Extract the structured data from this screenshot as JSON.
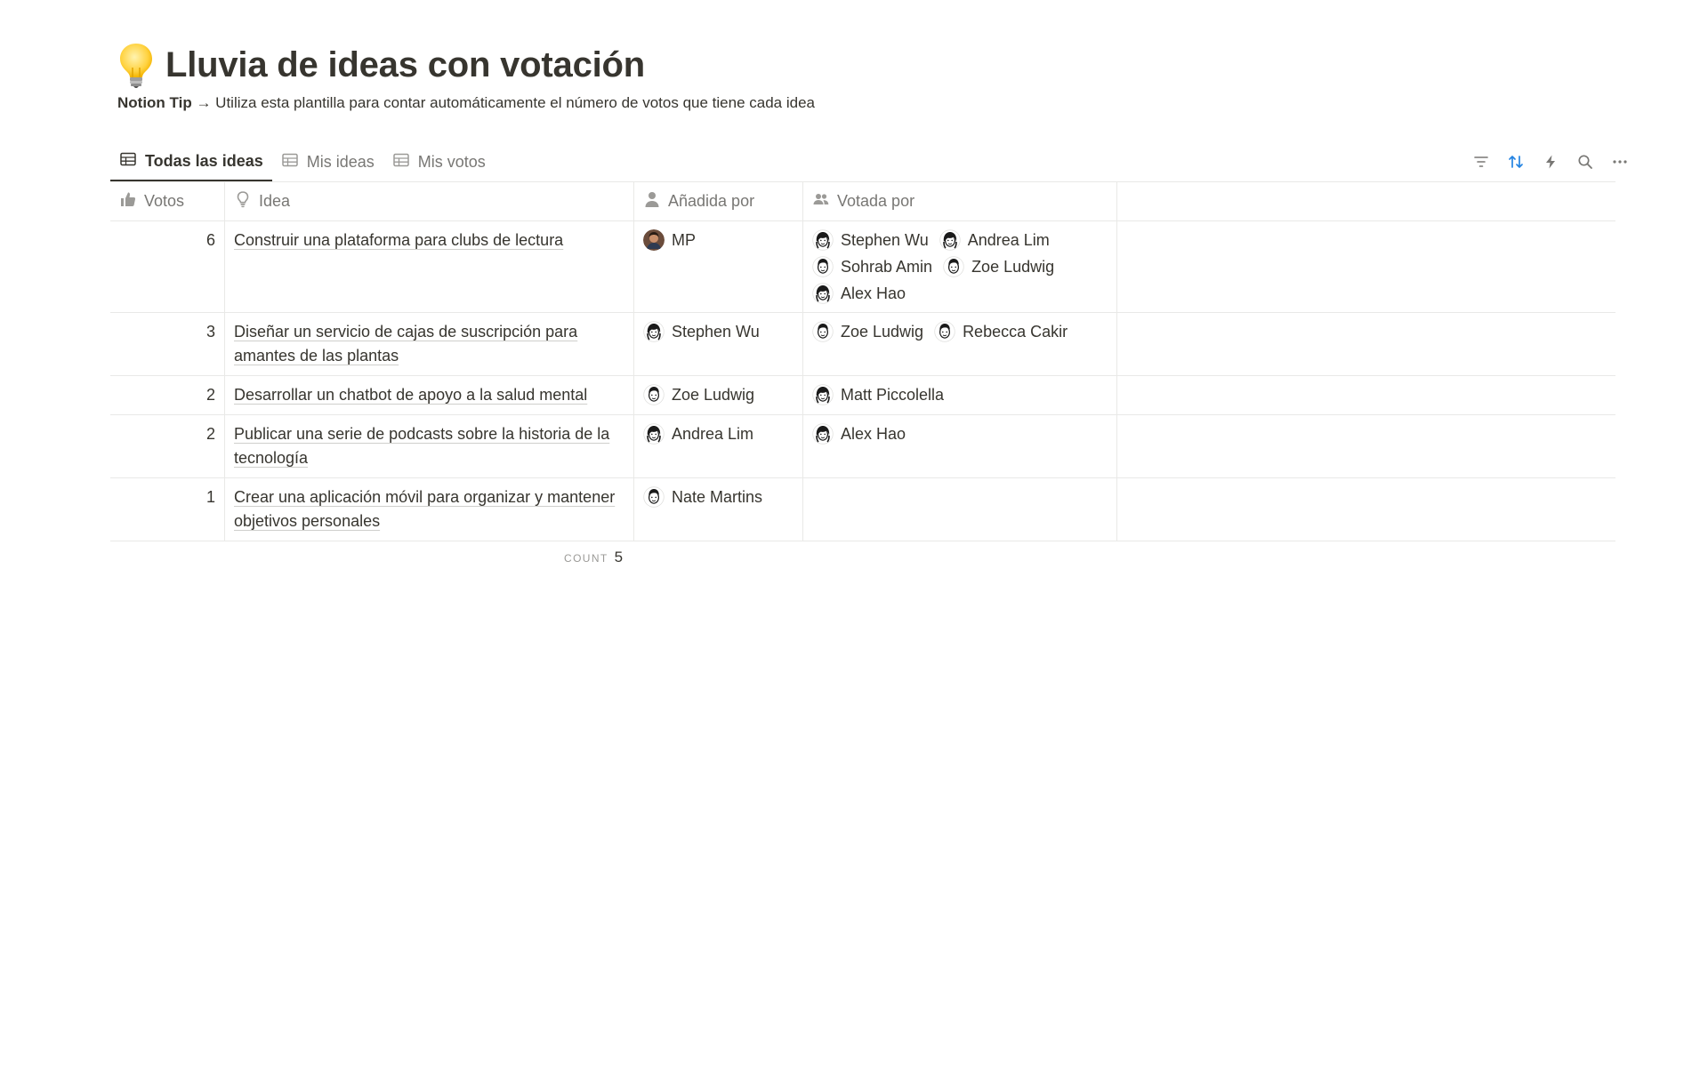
{
  "page": {
    "title": "Lluvia de ideas con votación",
    "emoji": "lightbulb-icon",
    "tip_bold": "Notion Tip",
    "tip_rest": " → Utiliza esta plantilla para contar automáticamente el número de votos que tiene cada idea"
  },
  "tabs": [
    {
      "label": "Todas las ideas",
      "icon": "table-icon",
      "active": true
    },
    {
      "label": "Mis ideas",
      "icon": "table-icon",
      "active": false
    },
    {
      "label": "Mis votos",
      "icon": "table-icon",
      "active": false
    }
  ],
  "toolbar": {
    "icons": [
      "filter-icon",
      "sort-icon",
      "lightning-icon",
      "search-icon",
      "more-icon"
    ],
    "accent_color": "#2383e2"
  },
  "columns": {
    "votes": "Votos",
    "idea": "Idea",
    "added_by": "Añadida por",
    "voted_by": "Votada por"
  },
  "rows": [
    {
      "votes": "6",
      "idea": "Construir una plataforma para clubs de lectura",
      "added_by": "MP",
      "voted_by": [
        "Stephen Wu",
        "Andrea Lim",
        "Sohrab Amin",
        "Zoe Ludwig",
        "Alex Hao"
      ]
    },
    {
      "votes": "3",
      "idea": "Diseñar un servicio de cajas de suscripción para amantes de las plantas",
      "added_by": "Stephen Wu",
      "voted_by": [
        "Zoe Ludwig",
        "Rebecca Cakir"
      ]
    },
    {
      "votes": "2",
      "idea": "Desarrollar un chatbot de apoyo a la salud mental",
      "added_by": "Zoe Ludwig",
      "voted_by": [
        "Matt Piccolella"
      ]
    },
    {
      "votes": "2",
      "idea": "Publicar una serie de podcasts sobre la historia de la tecnología",
      "added_by": "Andrea Lim",
      "voted_by": [
        "Alex Hao"
      ]
    },
    {
      "votes": "1",
      "idea": "Crear una aplicación móvil para organizar y mantener objetivos personales",
      "added_by": "Nate Martins",
      "voted_by": []
    }
  ],
  "footer": {
    "count_label": "COUNT",
    "count_value": "5"
  }
}
